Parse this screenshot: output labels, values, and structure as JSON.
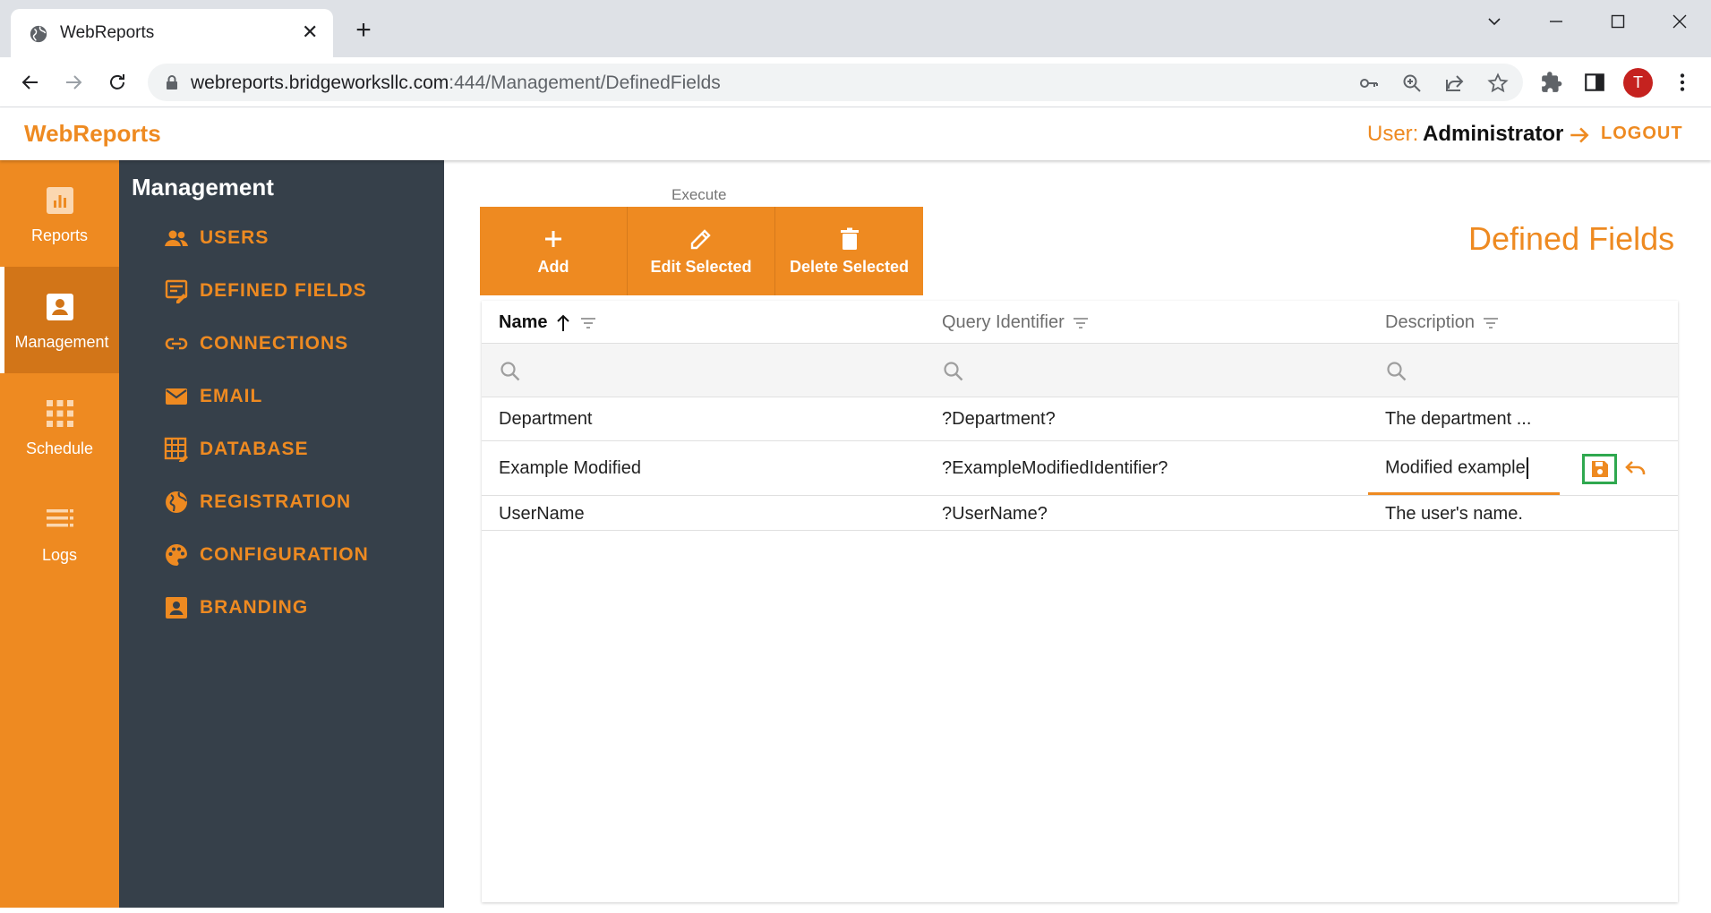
{
  "browser": {
    "tab_title": "WebReports",
    "url_host": "webreports.bridgeworksllc.com",
    "url_path": ":444/Management/DefinedFields",
    "profile_initial": "T"
  },
  "header": {
    "brand": "WebReports",
    "user_label": "User:",
    "user_name": "Administrator",
    "logout_label": "LOGOUT"
  },
  "rail": {
    "items": [
      {
        "label": "Reports",
        "icon": "bar-chart-icon"
      },
      {
        "label": "Management",
        "icon": "badge-icon",
        "active": true
      },
      {
        "label": "Schedule",
        "icon": "grid-icon"
      },
      {
        "label": "Logs",
        "icon": "list-icon"
      }
    ]
  },
  "sidebar": {
    "title": "Management",
    "items": [
      {
        "label": "USERS",
        "icon": "users-icon"
      },
      {
        "label": "DEFINED FIELDS",
        "icon": "defined-fields-icon"
      },
      {
        "label": "CONNECTIONS",
        "icon": "link-icon"
      },
      {
        "label": "EMAIL",
        "icon": "email-icon"
      },
      {
        "label": "DATABASE",
        "icon": "database-icon"
      },
      {
        "label": "REGISTRATION",
        "icon": "globe-icon"
      },
      {
        "label": "CONFIGURATION",
        "icon": "palette-icon"
      },
      {
        "label": "BRANDING",
        "icon": "badge-icon"
      }
    ]
  },
  "toolbar": {
    "group_label": "Execute",
    "add_label": "Add",
    "edit_label": "Edit Selected",
    "delete_label": "Delete Selected"
  },
  "page_title": "Defined Fields",
  "table": {
    "columns": [
      "Name",
      "Query Identifier",
      "Description"
    ],
    "sorted_column": "Name",
    "sort_direction": "ascending",
    "rows": [
      {
        "name": "Department",
        "query_identifier": "?Department?",
        "description": "The department ..."
      },
      {
        "name": "Example Modified",
        "query_identifier": "?ExampleModifiedIdentifier?",
        "description": "Modified example",
        "editing": true
      },
      {
        "name": "UserName",
        "query_identifier": "?UserName?",
        "description": "The user's name."
      }
    ]
  },
  "colors": {
    "accent": "#ee8a21",
    "sidebar_bg": "#36404a",
    "rail_active": "#d27518",
    "save_highlight": "#2fa84f"
  }
}
